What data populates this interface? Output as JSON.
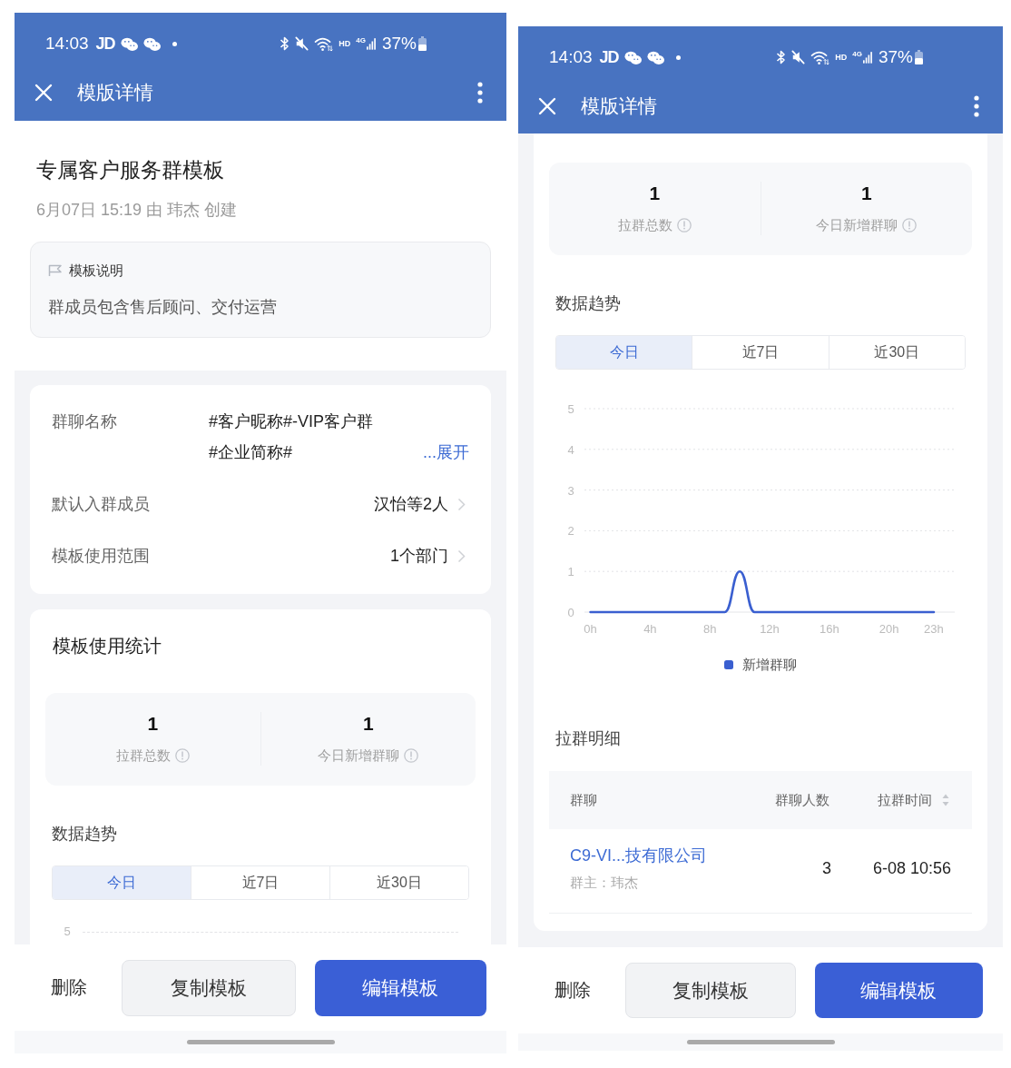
{
  "screens": [
    {
      "scrolled": false,
      "status_bar": {
        "time": "14:03",
        "app_label": "JD",
        "hd_label": "HD",
        "network_label": "4G",
        "battery": "37%"
      },
      "app_bar": {
        "title": "模版详情"
      },
      "sections": [
        {
          "kind": "template_header",
          "title": "专属客户服务群模板",
          "meta": "6月07日 15:19 由 玮杰 创建",
          "note": {
            "label": "模板说明",
            "text": "群成员包含售后顾问、交付运营"
          }
        },
        {
          "kind": "info_card",
          "rows": [
            {
              "kind": "expandable",
              "label": "群聊名称",
              "value_lines": [
                "#客户昵称#-VIP客户群",
                "#企业简称#"
              ],
              "action": "...展开"
            },
            {
              "kind": "navigate",
              "label": "默认入群成员",
              "value": "汉怡等2人"
            },
            {
              "kind": "navigate",
              "label": "模板使用范围",
              "value": "1个部门"
            }
          ]
        },
        {
          "kind": "stats_card",
          "title": "模板使用统计",
          "stats": [
            {
              "value": "1",
              "label": "拉群总数"
            },
            {
              "value": "1",
              "label": "今日新增群聊"
            }
          ],
          "trend_title": "数据趋势",
          "ranges": [
            {
              "label": "今日",
              "selected": true
            },
            {
              "label": "近7日",
              "selected": false
            },
            {
              "label": "近30日",
              "selected": false
            }
          ],
          "chart_peek_label": "5"
        }
      ],
      "footer": {
        "actions": [
          {
            "kind": "text",
            "label": "删除"
          },
          {
            "kind": "secondary",
            "label": "复制模板"
          },
          {
            "kind": "primary",
            "label": "编辑模板"
          }
        ]
      }
    },
    {
      "scrolled": true,
      "status_bar": {
        "time": "14:03",
        "app_label": "JD",
        "hd_label": "HD",
        "network_label": "4G",
        "battery": "37%"
      },
      "app_bar": {
        "title": "模版详情"
      },
      "sections": [
        {
          "kind": "stats_card",
          "stats": [
            {
              "value": "1",
              "label": "拉群总数"
            },
            {
              "value": "1",
              "label": "今日新增群聊"
            }
          ],
          "trend_title": "数据趋势",
          "ranges": [
            {
              "label": "今日",
              "selected": true
            },
            {
              "label": "近7日",
              "selected": false
            },
            {
              "label": "近30日",
              "selected": false
            }
          ],
          "chart_data": {
            "type": "line",
            "x": [
              0,
              1,
              2,
              3,
              4,
              5,
              6,
              7,
              8,
              9,
              10,
              11,
              12,
              13,
              14,
              15,
              16,
              17,
              18,
              19,
              20,
              21,
              22,
              23
            ],
            "xlim": [
              -0.4,
              24.4
            ],
            "ylim": [
              0,
              5
            ],
            "xticks": [
              {
                "value": 0,
                "label": "0h"
              },
              {
                "value": 4,
                "label": "4h"
              },
              {
                "value": 8,
                "label": "8h"
              },
              {
                "value": 12,
                "label": "12h"
              },
              {
                "value": 16,
                "label": "16h"
              },
              {
                "value": 20,
                "label": "20h"
              },
              {
                "value": 23,
                "label": "23h"
              }
            ],
            "yticks": [
              0,
              1,
              2,
              3,
              4,
              5
            ],
            "grid": true,
            "series": [
              {
                "name": "新增群聊",
                "color": "#3a5fd0",
                "values": [
                  0,
                  0,
                  0,
                  0,
                  0,
                  0,
                  0,
                  0,
                  0,
                  0,
                  1,
                  0,
                  0,
                  0,
                  0,
                  0,
                  0,
                  0,
                  0,
                  0,
                  0,
                  0,
                  0,
                  0
                ]
              }
            ]
          },
          "detail_title": "拉群明细",
          "table": {
            "columns": [
              {
                "label": "群聊",
                "sortable": false
              },
              {
                "label": "群聊人数",
                "sortable": false
              },
              {
                "label": "拉群时间",
                "sortable": true
              }
            ],
            "rows": [
              {
                "name": "C9-VI...技有限公司",
                "owner": "群主：玮杰",
                "members": "3",
                "time": "6-08 10:56"
              }
            ]
          }
        }
      ],
      "footer": {
        "actions": [
          {
            "kind": "text",
            "label": "删除"
          },
          {
            "kind": "secondary",
            "label": "复制模板"
          },
          {
            "kind": "primary",
            "label": "编辑模板"
          }
        ]
      }
    }
  ]
}
